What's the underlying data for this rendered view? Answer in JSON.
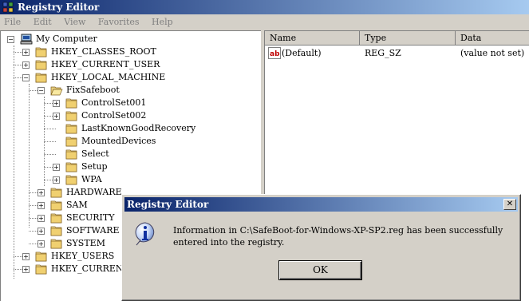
{
  "window": {
    "title": "Registry Editor"
  },
  "menu": [
    "File",
    "Edit",
    "View",
    "Favorites",
    "Help"
  ],
  "tree": [
    {
      "label": "My Computer",
      "icon": "computer-icon",
      "expander": "−",
      "level": 0
    },
    {
      "label": "HKEY_CLASSES_ROOT",
      "icon": "folder-icon",
      "expander": "+",
      "level": 1
    },
    {
      "label": "HKEY_CURRENT_USER",
      "icon": "folder-icon",
      "expander": "+",
      "level": 1
    },
    {
      "label": "HKEY_LOCAL_MACHINE",
      "icon": "folder-icon",
      "expander": "−",
      "level": 1
    },
    {
      "label": "FixSafeboot",
      "icon": "open-folder-icon",
      "expander": "−",
      "level": 2
    },
    {
      "label": "ControlSet001",
      "icon": "folder-icon",
      "expander": "+",
      "level": 3
    },
    {
      "label": "ControlSet002",
      "icon": "folder-icon",
      "expander": "+",
      "level": 3
    },
    {
      "label": "LastKnownGoodRecovery",
      "icon": "folder-icon",
      "expander": "",
      "level": 3
    },
    {
      "label": "MountedDevices",
      "icon": "folder-icon",
      "expander": "",
      "level": 3
    },
    {
      "label": "Select",
      "icon": "folder-icon",
      "expander": "",
      "level": 3
    },
    {
      "label": "Setup",
      "icon": "folder-icon",
      "expander": "+",
      "level": 3
    },
    {
      "label": "WPA",
      "icon": "folder-icon",
      "expander": "+",
      "level": 3
    },
    {
      "label": "HARDWARE",
      "icon": "folder-icon",
      "expander": "+",
      "level": 2
    },
    {
      "label": "SAM",
      "icon": "folder-icon",
      "expander": "+",
      "level": 2
    },
    {
      "label": "SECURITY",
      "icon": "folder-icon",
      "expander": "+",
      "level": 2
    },
    {
      "label": "SOFTWARE",
      "icon": "folder-icon",
      "expander": "+",
      "level": 2
    },
    {
      "label": "SYSTEM",
      "icon": "folder-icon",
      "expander": "+",
      "level": 2
    },
    {
      "label": "HKEY_USERS",
      "icon": "folder-icon",
      "expander": "+",
      "level": 1
    },
    {
      "label": "HKEY_CURRENT",
      "icon": "folder-icon",
      "expander": "+",
      "level": 1
    }
  ],
  "list": {
    "columns": [
      "Name",
      "Type",
      "Data"
    ],
    "rows": [
      {
        "name": "(Default)",
        "type": "REG_SZ",
        "data": "(value not set)",
        "icon": "string-value-icon"
      }
    ]
  },
  "dialog": {
    "title": "Registry Editor",
    "close_label": "✕",
    "message": "Information in C:\\SafeBoot-for-Windows-XP-SP2.reg has been successfully entered into the registry.",
    "ok_label": "OK",
    "icon": "info-icon"
  }
}
